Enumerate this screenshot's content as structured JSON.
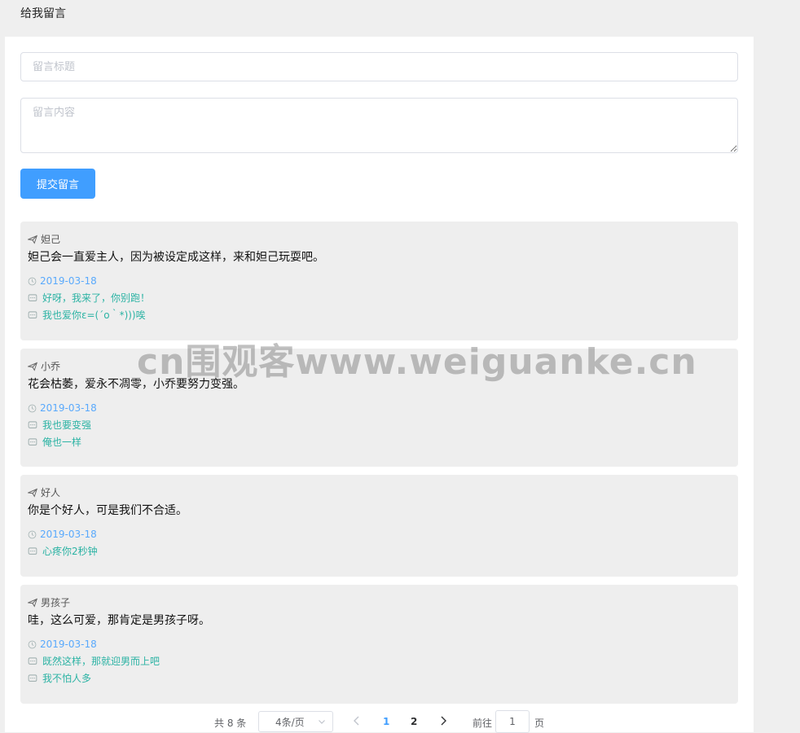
{
  "header": {
    "title": "给我留言"
  },
  "form": {
    "title_placeholder": "留言标题",
    "content_placeholder": "留言内容",
    "submit_label": "提交留言"
  },
  "messages": [
    {
      "author": "妲己",
      "content": "妲己会一直爱主人，因为被设定成这样，来和妲己玩耍吧。",
      "date": "2019-03-18",
      "replies": [
        "好呀，我来了，你别跑！",
        "我也爱你ε=(´ο｀*)))唉"
      ]
    },
    {
      "author": "小乔",
      "content": "花会枯萎，爱永不凋零，小乔要努力变强。",
      "date": "2019-03-18",
      "replies": [
        "我也要变强",
        "俺也一样"
      ]
    },
    {
      "author": "好人",
      "content": "你是个好人，可是我们不合适。",
      "date": "2019-03-18",
      "replies": [
        "心疼你2秒钟"
      ]
    },
    {
      "author": "男孩子",
      "content": "哇，这么可爱，那肯定是男孩子呀。",
      "date": "2019-03-18",
      "replies": [
        "既然这样，那就迎男而上吧",
        "我不怕人多"
      ]
    }
  ],
  "pagination": {
    "total_label": "共 8 条",
    "page_size_label": "4条/页",
    "pages": [
      "1",
      "2"
    ],
    "active_page": "1",
    "goto_label": "前往",
    "goto_value": "1",
    "page_suffix": "页"
  },
  "watermark": {
    "text": "cn围观客www.weiguanke.cn"
  }
}
